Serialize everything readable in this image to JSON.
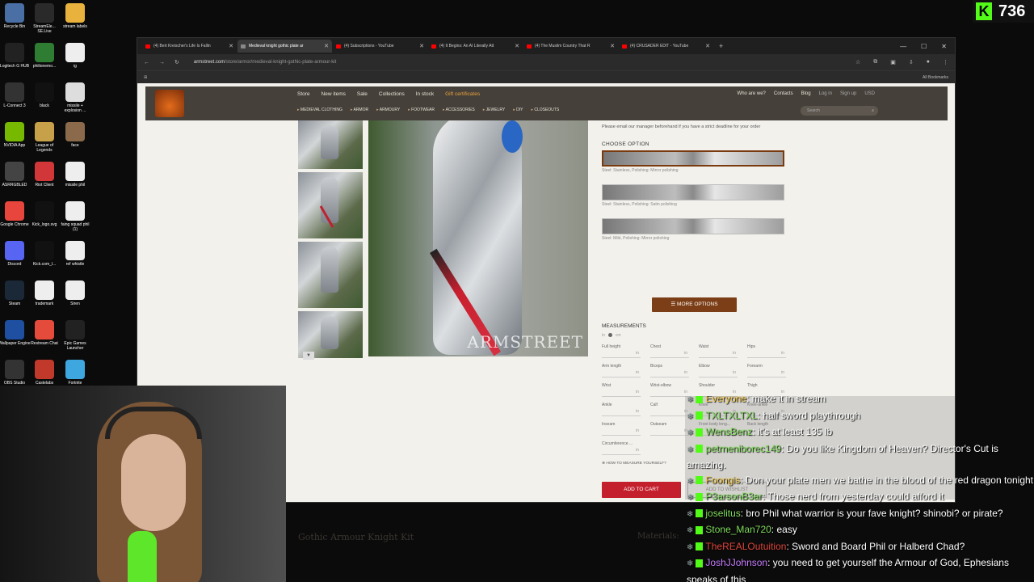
{
  "desktop": {
    "icons": [
      {
        "label": "Recycle Bin",
        "bg": "#4a6fa5"
      },
      {
        "label": "StreamEle... SE.Live",
        "bg": "#2a2a2a"
      },
      {
        "label": "stream labels",
        "bg": "#e8b23c"
      },
      {
        "label": "Logitech G HUB",
        "bg": "#222"
      },
      {
        "label": "philionemo...",
        "bg": "#2e7d32"
      },
      {
        "label": "ig",
        "bg": "#eee"
      },
      {
        "label": "L-Connect 3",
        "bg": "#333"
      },
      {
        "label": "black",
        "bg": "#111"
      },
      {
        "label": "missile + explosion ...",
        "bg": "#ddd"
      },
      {
        "label": "NVIDIA App",
        "bg": "#76b900"
      },
      {
        "label": "League of Legends",
        "bg": "#c7a14a"
      },
      {
        "label": "face",
        "bg": "#8a6a4a"
      },
      {
        "label": "ASRRGBLED",
        "bg": "#444"
      },
      {
        "label": "Riot Client",
        "bg": "#d13639"
      },
      {
        "label": "missile phil",
        "bg": "#eee"
      },
      {
        "label": "Google Chrome",
        "bg": "#e8453c"
      },
      {
        "label": "Kick_logo.svg",
        "bg": "#111"
      },
      {
        "label": "faing squad phil (1)",
        "bg": "#eee"
      },
      {
        "label": "Discord",
        "bg": "#5865f2"
      },
      {
        "label": "Kick.com_l...",
        "bg": "#111"
      },
      {
        "label": "ref whistle",
        "bg": "#eee"
      },
      {
        "label": "Steam",
        "bg": "#1b2838"
      },
      {
        "label": "trademark",
        "bg": "#eee"
      },
      {
        "label": "Siren",
        "bg": "#eee"
      },
      {
        "label": "Wallpaper Engine",
        "bg": "#1e4fa0"
      },
      {
        "label": "Restream Chat",
        "bg": "#e54b3a"
      },
      {
        "label": "Epic Games Launcher",
        "bg": "#222"
      },
      {
        "label": "OBS Studio",
        "bg": "#333"
      },
      {
        "label": "Castelabs",
        "bg": "#c0392b"
      },
      {
        "label": "Fortnite",
        "bg": "#3fa7e0"
      }
    ],
    "kick_count": "736"
  },
  "browser": {
    "tabs": [
      {
        "title": "(4) Bert Kreischer's Life Is Fallin",
        "active": false
      },
      {
        "title": "Medieval knight gothic plate ar",
        "active": true
      },
      {
        "title": "(4) Subscriptions - YouTube",
        "active": false
      },
      {
        "title": "(4) It Begins: An AI Literally Att",
        "active": false
      },
      {
        "title": "(4) The Muslim Country That R",
        "active": false
      },
      {
        "title": "(4) CRUSADER EDIT - YouTube",
        "active": false
      }
    ],
    "url_host": "armstreet.com",
    "url_path": "/store/armor/medieval-knight-gothic-plate-armour-kit",
    "bookmarks_label": "All Bookmarks"
  },
  "site": {
    "nav_main": [
      "Store",
      "New items",
      "Sale",
      "Collections",
      "In stock",
      "Gift certificates"
    ],
    "nav_right": [
      "Who are we?",
      "Contacts",
      "Blog",
      "Log in",
      "Sign up",
      "USD"
    ],
    "nav_sub": [
      "MEDIEVAL CLOTHING",
      "ARMOR",
      "ARMOURY",
      "FOOTWEAR",
      "ACCESSORIES",
      "JEWELRY",
      "DIY",
      "CLOSEOUTS"
    ],
    "search_placeholder": "Search",
    "watermark": "ARMSTREET"
  },
  "product": {
    "deadline_note": "Please email our manager beforehand if you have a strict deadline for your order",
    "choose_option": "CHOOSE OPTION",
    "options": [
      {
        "label": "Steel: Stainless, Polishing: Mirror polishing",
        "selected": true
      },
      {
        "label": "Steel: Stainless, Polishing: Satin polishing",
        "selected": false
      },
      {
        "label": "Steel: Mild, Polishing: Mirror polishing",
        "selected": false
      }
    ],
    "more_options": "MORE OPTIONS",
    "measurements_title": "MEASUREMENTS",
    "unit_in": "in",
    "unit_cm": "cm",
    "measurements": [
      "Full height",
      "Chest",
      "Waist",
      "Hips",
      "Arm length",
      "Biceps",
      "Elbow",
      "Forearm",
      "Wrist",
      "Wrist-elbow",
      "Shoulder",
      "Thigh",
      "Ankle",
      "Calf",
      "Knee",
      "Knee-ankle",
      "Inseam",
      "Outseam",
      "Front body leng...",
      "Back length",
      "Circumference ..."
    ],
    "how_to_measure": "HOW TO MEASURE YOURSELF?",
    "add_to_cart": "ADD TO CART",
    "add_to_wishlist": "ADD TO WISHLIST",
    "kit_title": "Gothic Armour Knight Kit",
    "materials": "Materials:"
  },
  "chat": [
    {
      "user": "Everyone",
      "color": "#f2c94c",
      "text": "make it in stream"
    },
    {
      "user": "TXLTXLTXL",
      "color": "#7fdc5a",
      "text": "half sword playthrough"
    },
    {
      "user": "WensBenz",
      "color": "#7fdc5a",
      "text": "it's at least 135 lb"
    },
    {
      "user": "petrneniborec149",
      "color": "#7fdc5a",
      "text": "Do you like Kingdom of Heaven? Director's Cut is amazing."
    },
    {
      "user": "Foongis",
      "color": "#f2c94c",
      "text": "Don your plate men we bathe in the blood of the red dragon tonight"
    },
    {
      "user": "P3arsonB3ar",
      "color": "#7fdc5a",
      "text": "Those nerd from yesterday could afford it"
    },
    {
      "user": "joselitus",
      "color": "#7fdc5a",
      "text": "bro Phil what warrior is your fave knight? shinobi? or pirate?"
    },
    {
      "user": "Stone_Man720",
      "color": "#7fdc5a",
      "text": "easy"
    },
    {
      "user": "TheREALOutuition",
      "color": "#e0453a",
      "text": "Sword and Board Phil or Halberd Chad?"
    },
    {
      "user": "JoshJJohnson",
      "color": "#c77dff",
      "text": "you need to get yourself the Armour of God, Ephesians speaks of this"
    }
  ]
}
